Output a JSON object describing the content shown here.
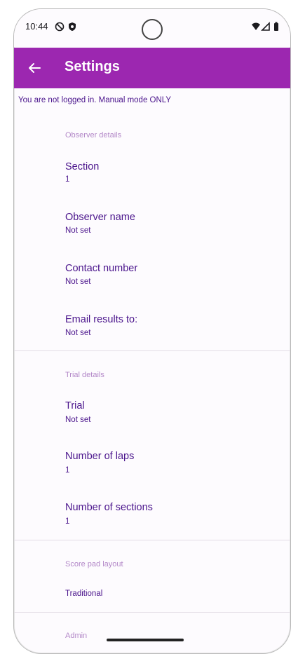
{
  "status": {
    "time": "10:44"
  },
  "appbar": {
    "title": "Settings"
  },
  "notice": "You are not logged in. Manual mode ONLY",
  "sections": {
    "observer": {
      "heading": "Observer details",
      "items": [
        {
          "title": "Section",
          "value": "1"
        },
        {
          "title": "Observer name",
          "value": "Not set"
        },
        {
          "title": "Contact number",
          "value": "Not set"
        },
        {
          "title": "Email results to:",
          "value": "Not set"
        }
      ]
    },
    "trial": {
      "heading": "Trial details",
      "items": [
        {
          "title": "Trial",
          "value": "Not set"
        },
        {
          "title": "Number of laps",
          "value": "1"
        },
        {
          "title": "Number of sections",
          "value": "1"
        }
      ]
    },
    "scorepad": {
      "heading": "Score pad layout",
      "value": "Traditional"
    },
    "admin": {
      "heading": "Admin"
    }
  },
  "colors": {
    "appbar": "#9c27b0",
    "accent_text": "#4a148c",
    "category": "#b388c8"
  },
  "icons": [
    "back-arrow-icon",
    "do-not-disturb-icon",
    "shield-icon",
    "wifi-icon",
    "signal-icon",
    "battery-icon"
  ]
}
